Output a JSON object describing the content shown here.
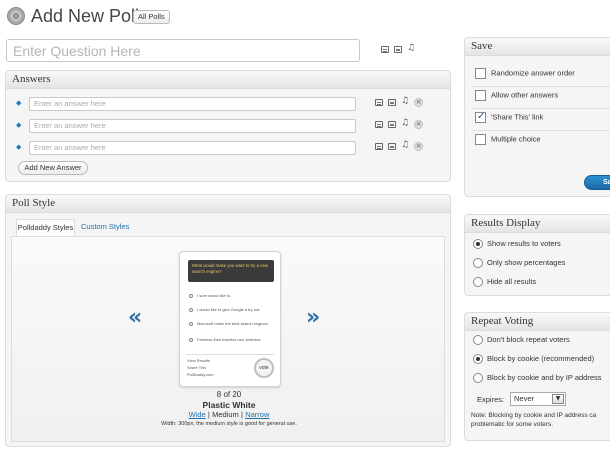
{
  "header": {
    "title": "Add New Poll",
    "all_polls_label": "All Polls"
  },
  "question": {
    "placeholder": "Enter Question Here"
  },
  "answers": {
    "title": "Answers",
    "items": [
      {
        "placeholder": "Enter an answer here"
      },
      {
        "placeholder": "Enter an answer here"
      },
      {
        "placeholder": "Enter an answer here"
      }
    ],
    "add_label": "Add New Answer"
  },
  "poll_style": {
    "title": "Poll Style",
    "tabs": [
      "Polldaddy Styles",
      "Custom Styles"
    ],
    "prev_arrow": "«",
    "next_arrow": "»",
    "preview": {
      "question": "What would make you want to try a new search engine?",
      "options": [
        "I sure would like to.",
        "I would like to give Google a try out.",
        "Microsoft make the best search engines.",
        "Fearless their insertus neo detectus."
      ],
      "footer": [
        "View Results",
        "Share This",
        "PollDaddy.com"
      ],
      "vote_label": "vote"
    },
    "counter": "8 of 20",
    "style_name": "Plastic White",
    "sizes": {
      "wide": "Wide",
      "medium": "Medium",
      "narrow": "Narrow",
      "sep": "|"
    },
    "width_note": "Width: 300px, the medium style is good for general use."
  },
  "save": {
    "title": "Save",
    "options": [
      {
        "label": "Randomize answer order",
        "checked": false
      },
      {
        "label": "Allow other answers",
        "checked": false
      },
      {
        "label": "'Share This' link",
        "checked": true
      },
      {
        "label": "Multiple choice",
        "checked": false
      }
    ],
    "button_label": "Sa"
  },
  "results_display": {
    "title": "Results Display",
    "options": [
      {
        "label": "Show results to voters",
        "selected": true
      },
      {
        "label": "Only show percentages",
        "selected": false
      },
      {
        "label": "Hide all results",
        "selected": false
      }
    ]
  },
  "repeat_voting": {
    "title": "Repeat Voting",
    "options": [
      {
        "label": "Don't block repeat voters",
        "selected": false
      },
      {
        "label": "Block by cookie (recommended)",
        "selected": true
      },
      {
        "label": "Block by cookie and by IP address",
        "selected": false
      }
    ],
    "expires_label": "Expires:",
    "expires_value": "Never",
    "note": "Note: Blocking by cookie and IP address ca problematic for some voters."
  }
}
